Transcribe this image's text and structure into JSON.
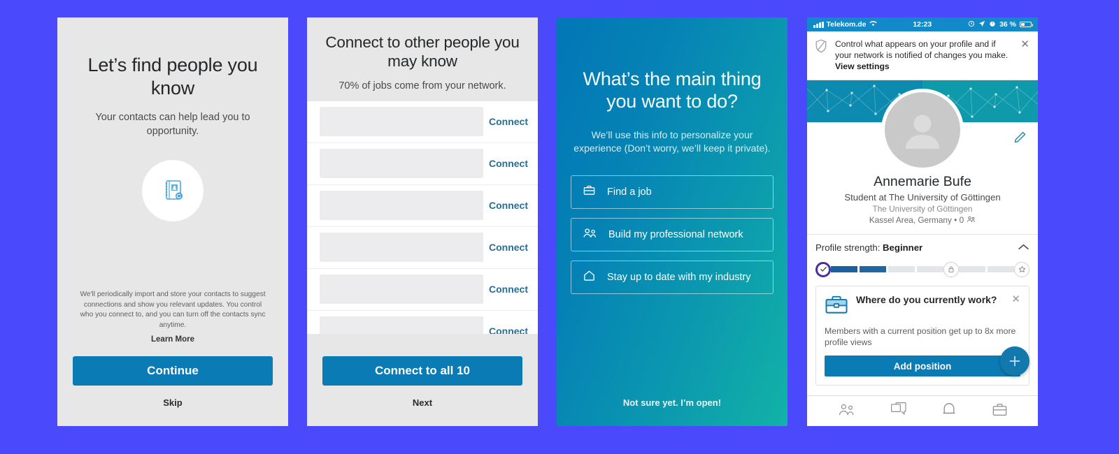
{
  "background_color": "#4a49fb",
  "accent_blue": "#0b7bb5",
  "screen1": {
    "name": "find-people-you-know",
    "title": "Let’s find people you know",
    "subtitle": "Your contacts can help lead you to opportunity.",
    "icon": "contacts-book-sync-icon",
    "legal": "We'll periodically import and store your contacts to suggest connections and show you relevant updates. You control who you connect to, and you can turn off the contacts sync anytime.",
    "learn_more": "Learn More",
    "primary_button": "Continue",
    "skip": "Skip"
  },
  "screen2": {
    "name": "connect-to-people",
    "title": "Connect to other people you may know",
    "subtitle": "70% of jobs come from your network.",
    "rows": [
      {
        "connect_label": "Connect"
      },
      {
        "connect_label": "Connect"
      },
      {
        "connect_label": "Connect"
      },
      {
        "connect_label": "Connect"
      },
      {
        "connect_label": "Connect"
      },
      {
        "connect_label": "Connect"
      }
    ],
    "primary_button": "Connect to all 10",
    "next": "Next"
  },
  "screen3": {
    "name": "main-thing-you-want-to-do",
    "title": "What’s the main thing you want to do?",
    "subtitle": "We’ll use this info to personalize your experience (Don’t worry, we’ll keep it private).",
    "options": [
      {
        "icon": "briefcase-icon",
        "label": "Find a job"
      },
      {
        "icon": "people-icon",
        "label": "Build my professional network"
      },
      {
        "icon": "home-icon",
        "label": "Stay up to date with my industry"
      }
    ],
    "skip_label": "Not sure yet. I’m open!"
  },
  "screen4": {
    "name": "linkedin-profile",
    "statusbar": {
      "carrier": "Telekom.de",
      "time": "12:23",
      "battery_percent": "36 %",
      "icons": [
        "signal-bars-icon",
        "wifi-icon",
        "rotation-lock-icon",
        "location-arrow-icon",
        "alarm-clock-icon",
        "battery-icon"
      ]
    },
    "notice": {
      "icon": "shield-icon",
      "text": "Control what appears on your profile and if your network is notified of changes you make. ",
      "link": "View settings",
      "close": "✕"
    },
    "profile": {
      "avatar_icon": "person-placeholder-icon",
      "edit_icon": "pencil-icon",
      "name": "Annemarie Bufe",
      "headline": "Student at The University of Göttingen",
      "company": "The University of Göttingen",
      "location": "Kassel Area, Germany • 0",
      "connections_icon": "people-icon"
    },
    "strength": {
      "label": "Profile strength: ",
      "level": "Beginner",
      "collapse_icon": "chevron-up-icon",
      "nodes": [
        "check-circle-icon",
        "lock-icon",
        "star-icon"
      ],
      "filled_segments": 2,
      "total_segments": 6
    },
    "card": {
      "icon": "briefcase-icon",
      "title": "Where do you currently work?",
      "body": "Members with a current position get up to 8x more profile views",
      "button": "Add position",
      "close": "✕"
    },
    "fab": {
      "icon": "plus-icon"
    },
    "tabbar": [
      {
        "icon": "my-network-icon",
        "name": "tab-my-network"
      },
      {
        "icon": "messaging-icon",
        "name": "tab-messaging"
      },
      {
        "icon": "notifications-bell-icon",
        "name": "tab-notifications"
      },
      {
        "icon": "jobs-briefcase-icon",
        "name": "tab-jobs"
      }
    ]
  }
}
